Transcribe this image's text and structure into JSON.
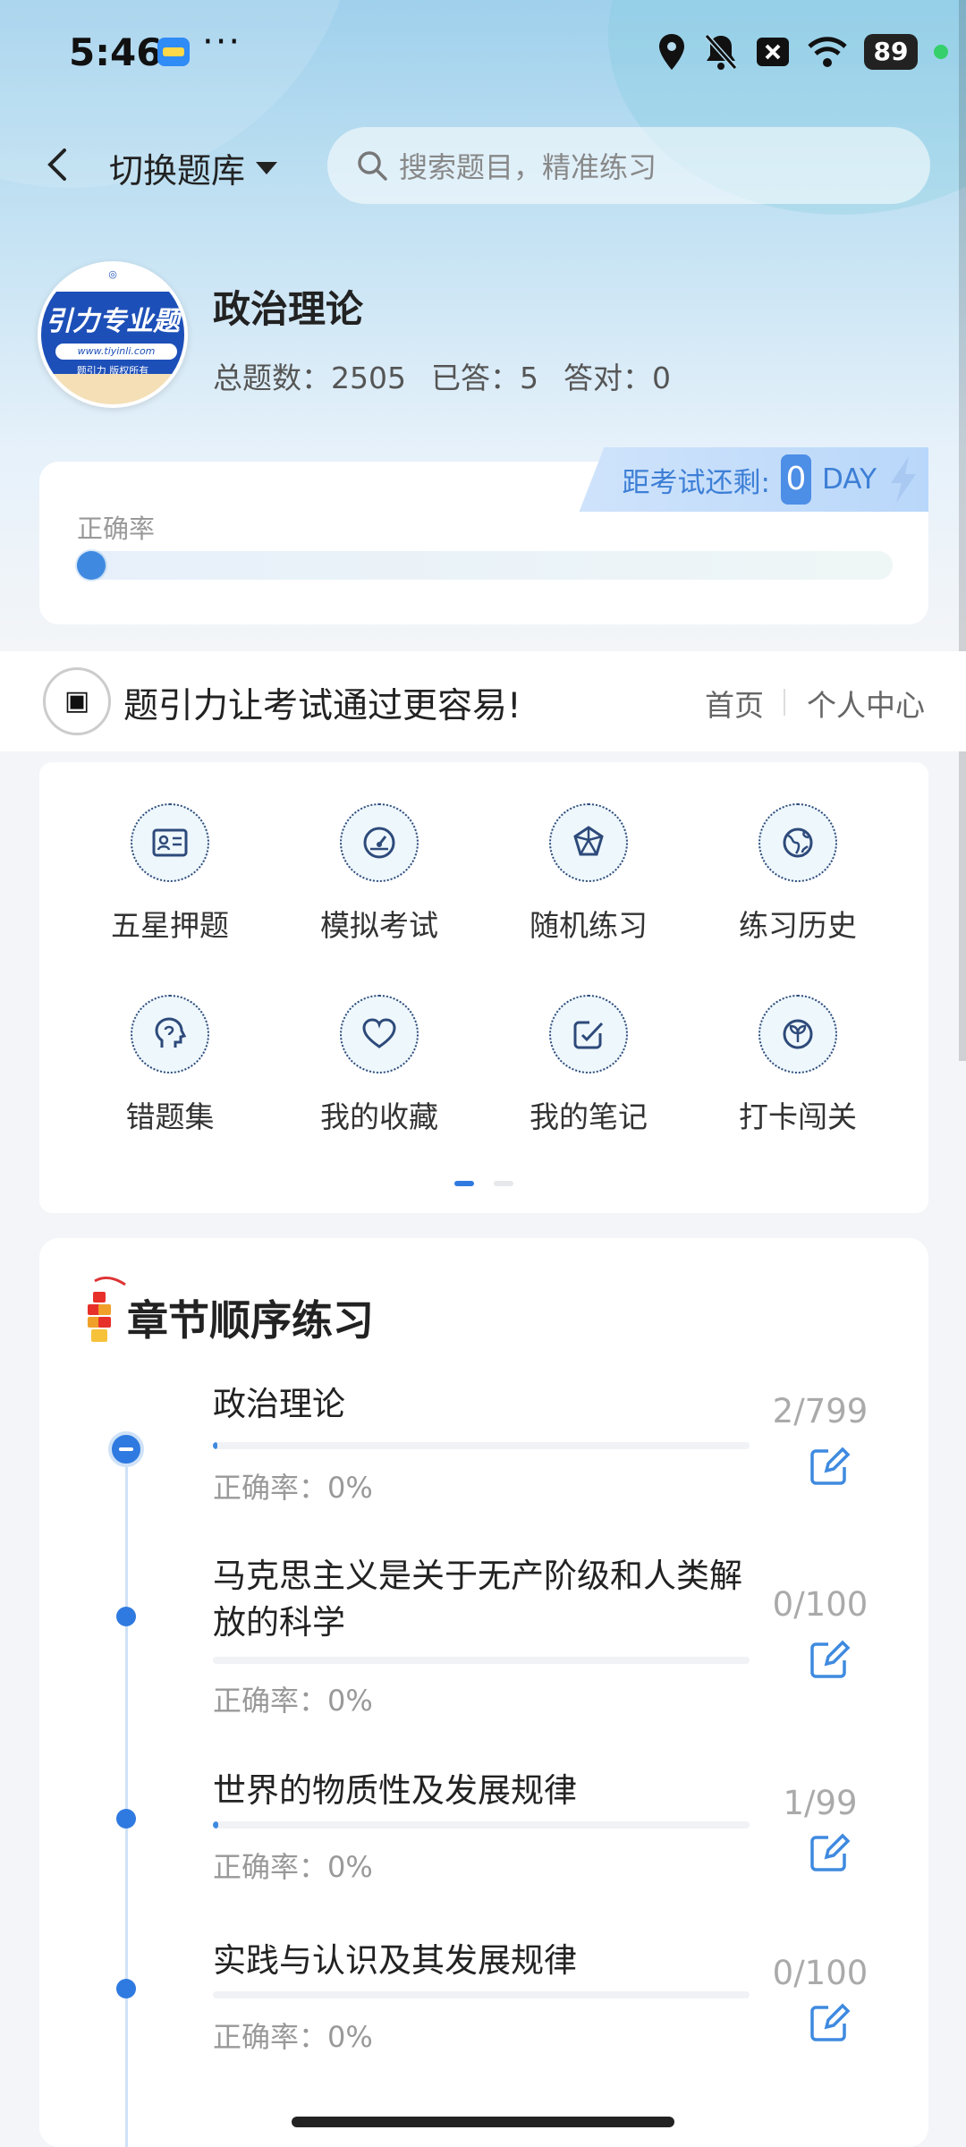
{
  "status_bar": {
    "time": "5:46",
    "more": "···",
    "battery": "89"
  },
  "header": {
    "switch_label": "切换题库",
    "search_placeholder": "搜索题目，精准练习"
  },
  "profile": {
    "logo_text": "引力专业题",
    "logo_url": "www.tiyinli.com",
    "logo_sub": "题引力 版权所有",
    "subject": "政治理论",
    "total_label": "总题数：2505",
    "answered_label": "已答：5",
    "correct_label": "答对：0"
  },
  "accuracy": {
    "countdown_label": "距考试还剩:",
    "countdown_value": "0",
    "countdown_unit": "DAY",
    "label": "正确率",
    "value": 0
  },
  "banner": {
    "logo_text": "题引力",
    "slogan": "题引力让考试通过更容易!",
    "home": "首页",
    "user_center": "个人中心"
  },
  "features": [
    {
      "label": "五星押题",
      "icon": "id-card-icon"
    },
    {
      "label": "模拟考试",
      "icon": "gauge-icon"
    },
    {
      "label": "随机练习",
      "icon": "cube-icon"
    },
    {
      "label": "练习历史",
      "icon": "globe-icon"
    },
    {
      "label": "错题集",
      "icon": "head-icon"
    },
    {
      "label": "我的收藏",
      "icon": "heart-icon"
    },
    {
      "label": "我的笔记",
      "icon": "note-icon"
    },
    {
      "label": "打卡闯关",
      "icon": "sprout-icon"
    }
  ],
  "section": {
    "title": "章节顺序练习",
    "chapters": [
      {
        "title": "政治理论",
        "rate": "正确率：0%",
        "count": "2/799",
        "progress": 0.0025
      },
      {
        "title": "马克思主义是关于无产阶级和人类解放的科学",
        "rate": "正确率：0%",
        "count": "0/100",
        "progress": 0
      },
      {
        "title": "世界的物质性及发展规律",
        "rate": "正确率：0%",
        "count": "1/99",
        "progress": 0.01
      },
      {
        "title": "实践与认识及其发展规律",
        "rate": "正确率：0%",
        "count": "0/100",
        "progress": 0
      }
    ]
  },
  "colors": {
    "accent": "#2f7ae0",
    "hero_top": "#9fd0ec",
    "badge": "#4d8ee6"
  }
}
